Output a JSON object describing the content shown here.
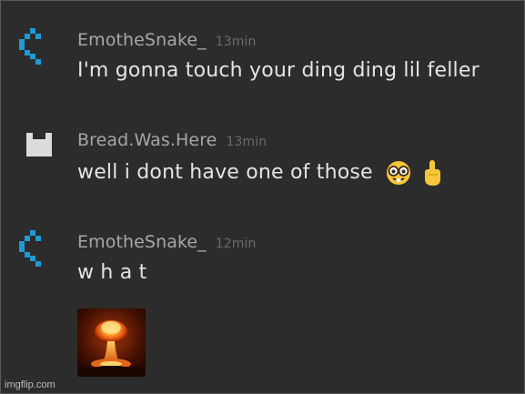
{
  "messages": [
    {
      "username": "EmotheSnake_",
      "time": "13min",
      "text": "I'm gonna touch your ding ding lil feller",
      "avatar_icon": "blue-pixel-snake-icon",
      "avatar_color": "#1e9ad6"
    },
    {
      "username": "Bread.Was.Here",
      "time": "13min",
      "text": "well i dont have one of those",
      "avatar_icon": "white-pixel-bread-icon",
      "avatar_color": "#dcdcdc",
      "emojis": [
        "nerd-face-emoji",
        "pointing-up-emoji"
      ]
    },
    {
      "username": "EmotheSnake_",
      "time": "12min",
      "text": "w h a t",
      "avatar_icon": "blue-pixel-snake-icon",
      "avatar_color": "#1e9ad6",
      "attachment": "nuclear-explosion-image"
    }
  ],
  "watermark": "imgflip.com",
  "colors": {
    "background": "#2c2c2c",
    "username": "#a7a7a7",
    "timestamp": "#6b6b6b",
    "message_text": "#e4e4e4"
  }
}
